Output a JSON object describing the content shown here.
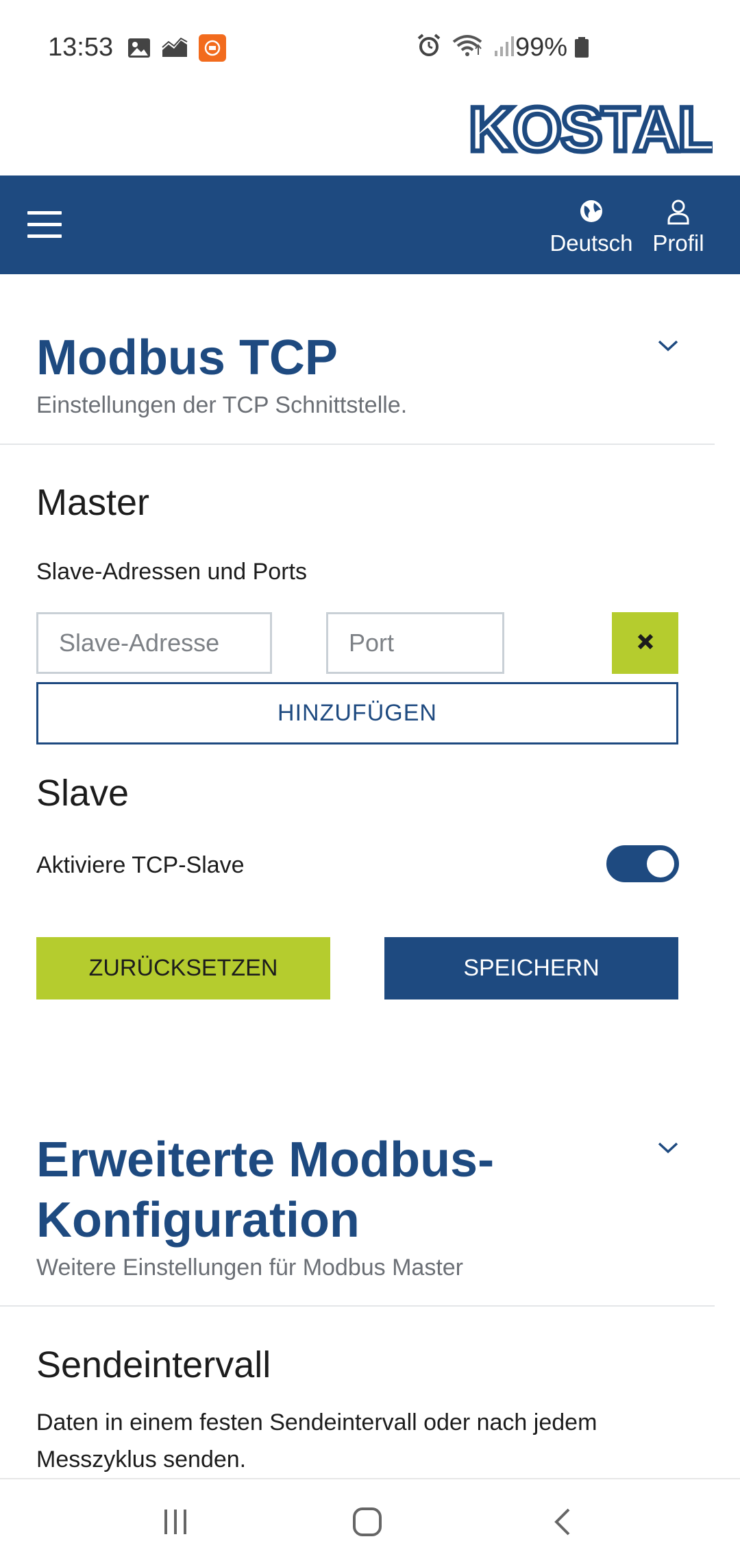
{
  "status_bar": {
    "time": "13:53",
    "battery_percent": "99%",
    "left_icons": [
      "gallery-icon",
      "chart-icon",
      "app-notification-icon"
    ],
    "right_icons": [
      "alarm-icon",
      "wifi-icon",
      "signal-icon",
      "battery-icon"
    ]
  },
  "brand": {
    "logo_text": "KOSTAL",
    "color": "#1e4a80",
    "accent": "#b5cc2e"
  },
  "navbar": {
    "language_label": "Deutsch",
    "profile_label": "Profil"
  },
  "modbus_tcp": {
    "title": "Modbus TCP",
    "subtitle": "Einstellungen der TCP Schnittstelle.",
    "master_heading": "Master",
    "slave_addresses_label": "Slave-Adressen und Ports",
    "slave_address_placeholder": "Slave-Adresse",
    "port_placeholder": "Port",
    "add_button": "HINZUFÜGEN",
    "slave_heading": "Slave",
    "activate_slave_label": "Aktiviere TCP-Slave",
    "activate_slave_enabled": true,
    "reset_button": "ZURÜCKSETZEN",
    "save_button": "SPEICHERN"
  },
  "extended_config": {
    "title_line1": "Erweiterte Modbus-",
    "title_line2": "Konfiguration",
    "subtitle": "Weitere Einstellungen für Modbus Master",
    "send_interval_heading": "Sendeintervall",
    "send_interval_text": "Daten in einem festen Sendeintervall oder nach jedem Messzyklus senden."
  }
}
